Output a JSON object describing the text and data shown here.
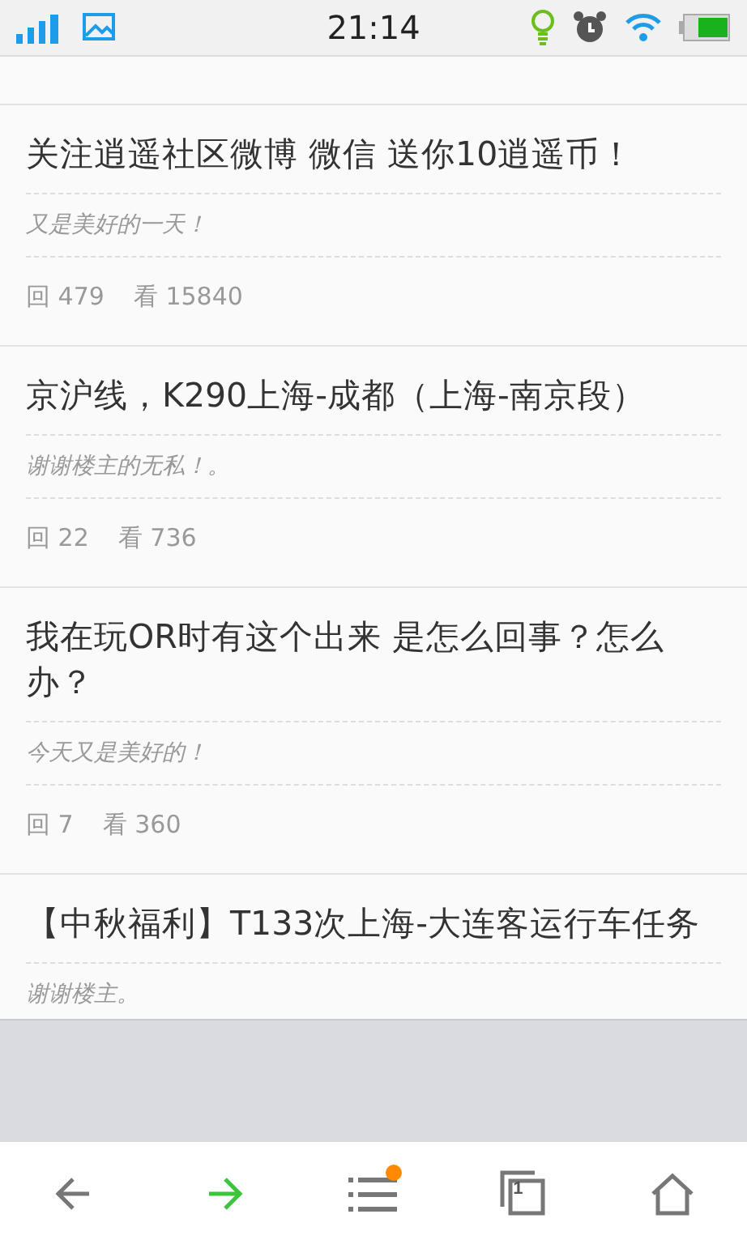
{
  "status_bar": {
    "time": "21:14"
  },
  "posts": [
    {
      "title": "关注逍遥社区微博 微信 送你10逍遥币！",
      "reply": "又是美好的一天！",
      "replies_label": "回",
      "replies": "479",
      "views_label": "看",
      "views": "15840"
    },
    {
      "title": "京沪线，K290上海-成都（上海-南京段）",
      "reply": "谢谢楼主的无私！。",
      "replies_label": "回",
      "replies": "22",
      "views_label": "看",
      "views": "736"
    },
    {
      "title": "我在玩OR时有这个出来 是怎么回事？怎么办？",
      "reply": "今天又是美好的！",
      "replies_label": "回",
      "replies": "7",
      "views_label": "看",
      "views": "360"
    },
    {
      "title": "【中秋福利】T133次上海-大连客运行车任务",
      "reply": "谢谢楼主。"
    }
  ],
  "toolbar": {
    "menu_badge": true,
    "tab_count": "1"
  }
}
